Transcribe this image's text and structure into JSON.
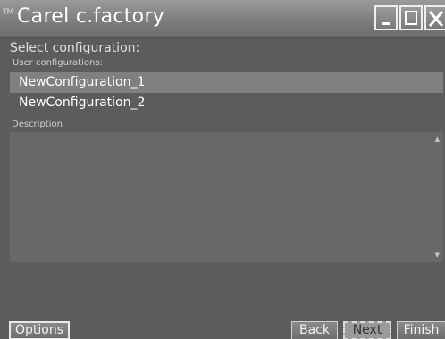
{
  "window": {
    "logo": "TM",
    "title": "Carel c.factory"
  },
  "main": {
    "select_label": "Select configuration:",
    "user_configs_label": "User configurations:",
    "configurations": [
      "NewConfiguration_1",
      "NewConfiguration_2"
    ],
    "selected_index": 0,
    "description_label": "Description",
    "description_text": ""
  },
  "footer": {
    "options_label": "Options",
    "back_label": "Back",
    "next_label": "Next",
    "finish_label": "Finish"
  },
  "icons": {
    "minimize": "minimize-icon",
    "maximize": "maximize-icon",
    "close": "close-icon",
    "scroll_up": "scroll-up-icon",
    "scroll_down": "scroll-down-icon"
  }
}
